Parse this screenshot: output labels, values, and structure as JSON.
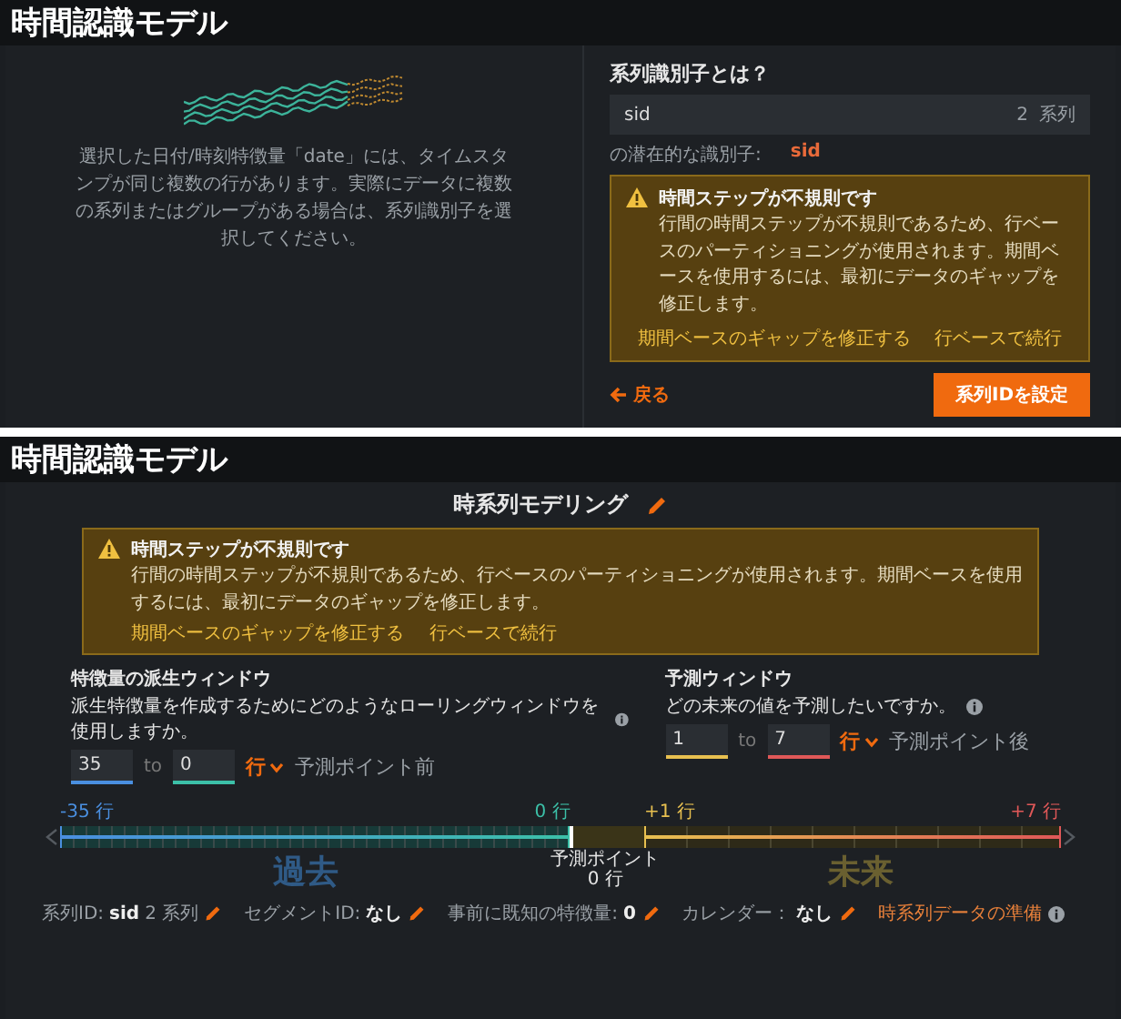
{
  "header_top": {
    "title": "時間認識モデル"
  },
  "series_panel": {
    "description": "選択した日付/時刻特徴量「date」には、タイムスタンプが同じ複数の行があります。実際にデータに複数の系列またはグループがある場合は、系列識別子を選択してください。",
    "question": "系列識別子とは？",
    "field": {
      "value": "sid",
      "count": "2",
      "unit": "系列"
    },
    "potential_label": "の潜在的な識別子:",
    "potential_value": "sid",
    "warning": {
      "title": "時間ステップが不規則です",
      "text": "行間の時間ステップが不規則であるため、行ベースのパーティショニングが使用されます。期間ベースを使用するには、最初にデータのギャップを修正します。",
      "actions": [
        "期間ベースのギャップを修正する",
        "行ベースで続行"
      ]
    },
    "back": "戻る",
    "submit": "系列IDを設定"
  },
  "header_bottom": {
    "title": "時間認識モデル"
  },
  "modeling": {
    "title": "時系列モデリング",
    "warning": {
      "title": "時間ステップが不規則です",
      "text": "行間の時間ステップが不規則であるため、行ベースのパーティショニングが使用されます。期間ベースを使用するには、最初にデータのギャップを修正します。",
      "actions": [
        "期間ベースのギャップを修正する",
        "行ベースで続行"
      ]
    },
    "windows": [
      {
        "title": "特徴量の派生ウィンドウ",
        "question": "派生特徴量を作成するためにどのようなローリングウィンドウを使用しますか。",
        "inputs": [
          {
            "value": "35",
            "color": "#4a8fe0"
          },
          {
            "value": "0",
            "color": "#3cc0a8"
          }
        ],
        "to": "to",
        "unit": "行",
        "suffix": "予測ポイント前"
      },
      {
        "title": "予測ウィンドウ",
        "question": "どの未来の値を予測したいですか。",
        "inputs": [
          {
            "value": "1",
            "color": "#e8c050"
          },
          {
            "value": "7",
            "color": "#e05858"
          }
        ],
        "to": "to",
        "unit": "行",
        "suffix": "予測ポイント後"
      }
    ],
    "timeline": {
      "labels": [
        "-35 行",
        "0 行",
        "+1 行",
        "+7 行"
      ],
      "past": "過去",
      "point": "予測ポイント",
      "point_rows": "0 行",
      "future": "未来"
    },
    "footer": [
      {
        "kind": "field",
        "label": "系列ID:",
        "value": "sid",
        "extra": "2 系列"
      },
      {
        "kind": "field",
        "label": "セグメントID:",
        "value": "なし"
      },
      {
        "kind": "field",
        "label": "事前に既知の特徴量:",
        "value": "0"
      },
      {
        "kind": "field",
        "label": "カレンダー：",
        "value": "なし"
      },
      {
        "kind": "link",
        "label": "時系列データの準備"
      }
    ]
  }
}
